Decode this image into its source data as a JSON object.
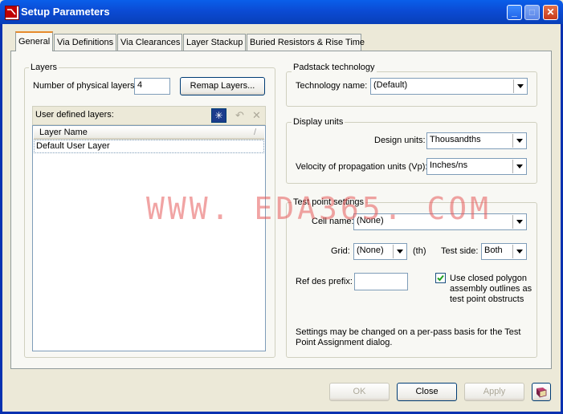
{
  "window": {
    "title": "Setup Parameters"
  },
  "tabs": [
    {
      "label": "General"
    },
    {
      "label": "Via Definitions"
    },
    {
      "label": "Via Clearances"
    },
    {
      "label": "Layer Stackup"
    },
    {
      "label": "Buried Resistors & Rise Time"
    }
  ],
  "layers": {
    "group_title": "Layers",
    "num_label": "Number of physical layers:",
    "num_value": "4",
    "remap_label": "Remap Layers...",
    "user_defined_label": "User defined layers:",
    "column_header": "Layer Name",
    "rows": [
      "Default User Layer"
    ]
  },
  "padstack": {
    "group_title": "Padstack technology",
    "tech_label": "Technology name:",
    "tech_value": "(Default)"
  },
  "display_units": {
    "group_title": "Display units",
    "design_label": "Design units:",
    "design_value": "Thousandths",
    "velocity_label": "Velocity of propagation units (Vp):",
    "velocity_value": "Inches/ns"
  },
  "test_point": {
    "group_title": "Test point settings",
    "cell_label": "Cell name:",
    "cell_value": "(None)",
    "grid_label": "Grid:",
    "grid_value": "(None)",
    "grid_unit": "(th)",
    "side_label": "Test side:",
    "side_value": "Both",
    "ref_label": "Ref des prefix:",
    "ref_value": "",
    "checkbox_label_1": "Use closed polygon",
    "checkbox_label_2": "assembly outlines as",
    "checkbox_label_3": "test point obstructs",
    "checkbox_checked": true,
    "note_1": "Settings may be changed on a per-pass basis for the Test",
    "note_2": "Point Assignment dialog."
  },
  "watermark": "WWW. EDA365. COM",
  "footer": {
    "ok_label": "OK",
    "close_label": "Close",
    "apply_label": "Apply"
  },
  "icons": {
    "title": "app-icon",
    "new_layer": "star-icon",
    "undo": "undo-icon",
    "delete": "delete-icon",
    "help": "book-icon"
  }
}
